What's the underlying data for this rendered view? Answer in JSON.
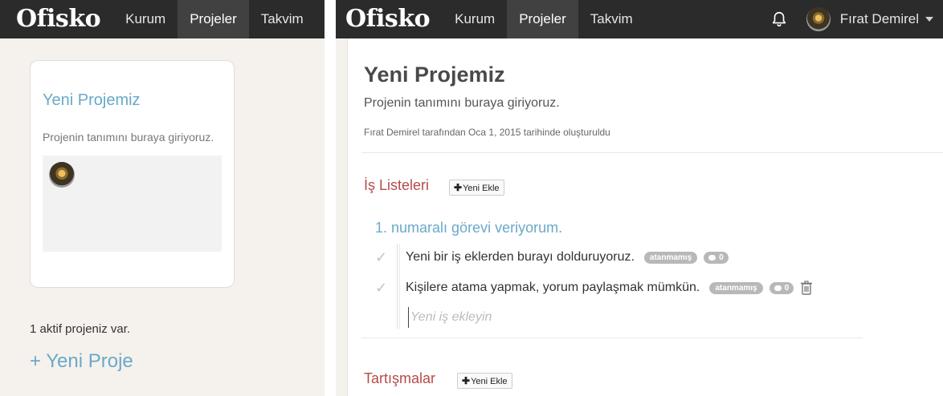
{
  "brand": "Ofisko",
  "nav": {
    "kurum": "Kurum",
    "projeler": "Projeler",
    "takvim": "Takvim"
  },
  "left": {
    "project_card": {
      "title": "Yeni Projemiz",
      "description": "Projenin tanımını buraya giriyoruz."
    },
    "active_count": "1 aktif projeniz var.",
    "new_project": "+ Yeni Proje"
  },
  "user": {
    "name": "Fırat Demirel"
  },
  "project": {
    "title": "Yeni Projemiz",
    "description": "Projenin tanımını buraya giriyoruz.",
    "meta": "Fırat Demirel tarafından Oca 1, 2015 tarihinde oluşturuldu"
  },
  "sections": {
    "tasklists": "İş Listeleri",
    "discussions": "Tartışmalar",
    "add_new": "Yeni Ekle"
  },
  "tasklist": {
    "title": "1. numaralı görevi veriyorum.",
    "tasks": [
      {
        "text": "Yeni bir iş eklerden burayı dolduruyoruz.",
        "tag": "atanmamış",
        "comments": "0"
      },
      {
        "text": "Kişilere atama yapmak, yorum paylaşmak mümkün.",
        "tag": "atanmamış",
        "comments": "0"
      }
    ],
    "new_task_placeholder": "Yeni iş ekleyin"
  },
  "icons": {
    "check": "check-icon",
    "bell": "bell-icon",
    "trash": "trash-icon",
    "comment": "comment-icon",
    "plus": "plus-icon"
  },
  "colors": {
    "accent_blue": "#6aa9c8",
    "section_red": "#b64a4a",
    "topbar": "#2b2b2b"
  }
}
